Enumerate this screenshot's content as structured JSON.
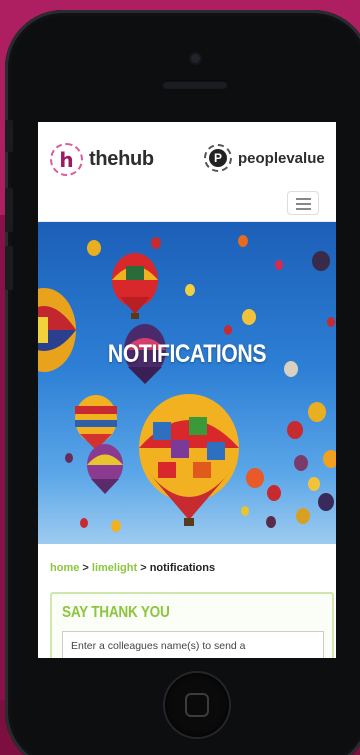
{
  "header": {
    "hub_mark": "h",
    "hub_name": "thehub",
    "pv_mark": "P",
    "pv_name": "peoplevalue"
  },
  "hero": {
    "title": "NOTIFICATIONS"
  },
  "breadcrumb": {
    "items": [
      "home",
      "limelight",
      "notifications"
    ],
    "separator": ">"
  },
  "card": {
    "title": "SAY THANK YOU",
    "input_placeholder": "Enter a colleagues name(s) to send a"
  },
  "colors": {
    "accent_green": "#8cc63f",
    "brand_magenta": "#a0185f",
    "background": "#9c1655"
  },
  "icons": [
    "hamburger-menu-icon",
    "home-button-icon"
  ]
}
